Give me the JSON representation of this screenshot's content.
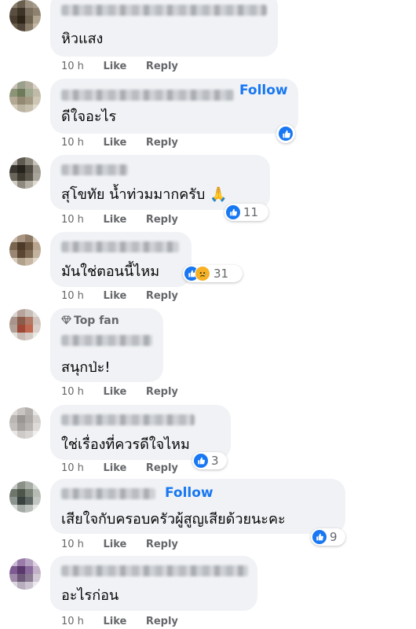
{
  "meta_labels": {
    "like": "Like",
    "reply": "Reply"
  },
  "colors": {
    "accent": "#1877f2",
    "bubble": "#f0f2f5",
    "meta": "#65676b"
  },
  "comments": [
    {
      "text": "หิวแสง",
      "time": "10 h",
      "reactions": null
    },
    {
      "text": "ดีใจอะไร",
      "time": "10 h",
      "follow": "Follow",
      "reactions": {
        "types": [
          "like"
        ],
        "count": ""
      }
    },
    {
      "text": "สุโขทัย น้ำท่วมมากครับ 🙏",
      "time": "10 h",
      "reactions": {
        "types": [
          "like"
        ],
        "count": "11"
      }
    },
    {
      "text": "มันใช่ตอนนี้ไหม",
      "time": "10 h",
      "reactions": {
        "types": [
          "like",
          "sad"
        ],
        "count": "31"
      }
    },
    {
      "badge": "Top fan",
      "text": "สนุกป่ะ!",
      "time": "10 h",
      "reactions": null
    },
    {
      "text": "ใช่เรื่องที่ควรดีใจไหม",
      "time": "10 h",
      "reactions": {
        "types": [
          "like"
        ],
        "count": "3"
      }
    },
    {
      "text": "เสียใจกับครอบครัวผู้สูญเสียด้วยนะคะ",
      "time": "10 h",
      "follow": "Follow",
      "reactions": {
        "types": [
          "like"
        ],
        "count": "9"
      }
    },
    {
      "text": "อะไรก่อน",
      "time": "10 h",
      "reactions": null
    }
  ]
}
